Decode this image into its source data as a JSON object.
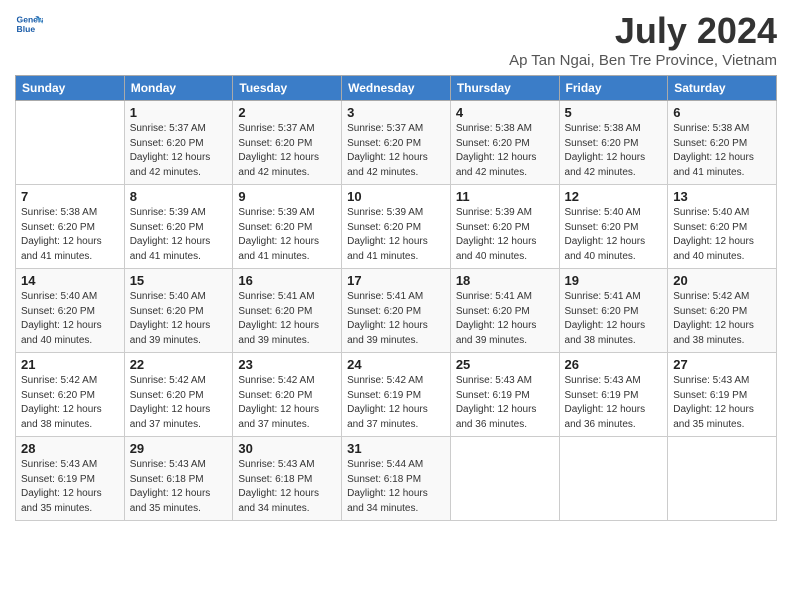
{
  "header": {
    "logo_line1": "General",
    "logo_line2": "Blue",
    "title": "July 2024",
    "subtitle": "Ap Tan Ngai, Ben Tre Province, Vietnam"
  },
  "days_of_week": [
    "Sunday",
    "Monday",
    "Tuesday",
    "Wednesday",
    "Thursday",
    "Friday",
    "Saturday"
  ],
  "weeks": [
    [
      {
        "day": "",
        "sunrise": "",
        "sunset": "",
        "daylight": ""
      },
      {
        "day": "1",
        "sunrise": "5:37 AM",
        "sunset": "6:20 PM",
        "daylight": "12 hours and 42 minutes."
      },
      {
        "day": "2",
        "sunrise": "5:37 AM",
        "sunset": "6:20 PM",
        "daylight": "12 hours and 42 minutes."
      },
      {
        "day": "3",
        "sunrise": "5:37 AM",
        "sunset": "6:20 PM",
        "daylight": "12 hours and 42 minutes."
      },
      {
        "day": "4",
        "sunrise": "5:38 AM",
        "sunset": "6:20 PM",
        "daylight": "12 hours and 42 minutes."
      },
      {
        "day": "5",
        "sunrise": "5:38 AM",
        "sunset": "6:20 PM",
        "daylight": "12 hours and 42 minutes."
      },
      {
        "day": "6",
        "sunrise": "5:38 AM",
        "sunset": "6:20 PM",
        "daylight": "12 hours and 41 minutes."
      }
    ],
    [
      {
        "day": "7",
        "sunrise": "5:38 AM",
        "sunset": "6:20 PM",
        "daylight": "12 hours and 41 minutes."
      },
      {
        "day": "8",
        "sunrise": "5:39 AM",
        "sunset": "6:20 PM",
        "daylight": "12 hours and 41 minutes."
      },
      {
        "day": "9",
        "sunrise": "5:39 AM",
        "sunset": "6:20 PM",
        "daylight": "12 hours and 41 minutes."
      },
      {
        "day": "10",
        "sunrise": "5:39 AM",
        "sunset": "6:20 PM",
        "daylight": "12 hours and 41 minutes."
      },
      {
        "day": "11",
        "sunrise": "5:39 AM",
        "sunset": "6:20 PM",
        "daylight": "12 hours and 40 minutes."
      },
      {
        "day": "12",
        "sunrise": "5:40 AM",
        "sunset": "6:20 PM",
        "daylight": "12 hours and 40 minutes."
      },
      {
        "day": "13",
        "sunrise": "5:40 AM",
        "sunset": "6:20 PM",
        "daylight": "12 hours and 40 minutes."
      }
    ],
    [
      {
        "day": "14",
        "sunrise": "5:40 AM",
        "sunset": "6:20 PM",
        "daylight": "12 hours and 40 minutes."
      },
      {
        "day": "15",
        "sunrise": "5:40 AM",
        "sunset": "6:20 PM",
        "daylight": "12 hours and 39 minutes."
      },
      {
        "day": "16",
        "sunrise": "5:41 AM",
        "sunset": "6:20 PM",
        "daylight": "12 hours and 39 minutes."
      },
      {
        "day": "17",
        "sunrise": "5:41 AM",
        "sunset": "6:20 PM",
        "daylight": "12 hours and 39 minutes."
      },
      {
        "day": "18",
        "sunrise": "5:41 AM",
        "sunset": "6:20 PM",
        "daylight": "12 hours and 39 minutes."
      },
      {
        "day": "19",
        "sunrise": "5:41 AM",
        "sunset": "6:20 PM",
        "daylight": "12 hours and 38 minutes."
      },
      {
        "day": "20",
        "sunrise": "5:42 AM",
        "sunset": "6:20 PM",
        "daylight": "12 hours and 38 minutes."
      }
    ],
    [
      {
        "day": "21",
        "sunrise": "5:42 AM",
        "sunset": "6:20 PM",
        "daylight": "12 hours and 38 minutes."
      },
      {
        "day": "22",
        "sunrise": "5:42 AM",
        "sunset": "6:20 PM",
        "daylight": "12 hours and 37 minutes."
      },
      {
        "day": "23",
        "sunrise": "5:42 AM",
        "sunset": "6:20 PM",
        "daylight": "12 hours and 37 minutes."
      },
      {
        "day": "24",
        "sunrise": "5:42 AM",
        "sunset": "6:19 PM",
        "daylight": "12 hours and 37 minutes."
      },
      {
        "day": "25",
        "sunrise": "5:43 AM",
        "sunset": "6:19 PM",
        "daylight": "12 hours and 36 minutes."
      },
      {
        "day": "26",
        "sunrise": "5:43 AM",
        "sunset": "6:19 PM",
        "daylight": "12 hours and 36 minutes."
      },
      {
        "day": "27",
        "sunrise": "5:43 AM",
        "sunset": "6:19 PM",
        "daylight": "12 hours and 35 minutes."
      }
    ],
    [
      {
        "day": "28",
        "sunrise": "5:43 AM",
        "sunset": "6:19 PM",
        "daylight": "12 hours and 35 minutes."
      },
      {
        "day": "29",
        "sunrise": "5:43 AM",
        "sunset": "6:18 PM",
        "daylight": "12 hours and 35 minutes."
      },
      {
        "day": "30",
        "sunrise": "5:43 AM",
        "sunset": "6:18 PM",
        "daylight": "12 hours and 34 minutes."
      },
      {
        "day": "31",
        "sunrise": "5:44 AM",
        "sunset": "6:18 PM",
        "daylight": "12 hours and 34 minutes."
      },
      {
        "day": "",
        "sunrise": "",
        "sunset": "",
        "daylight": ""
      },
      {
        "day": "",
        "sunrise": "",
        "sunset": "",
        "daylight": ""
      },
      {
        "day": "",
        "sunrise": "",
        "sunset": "",
        "daylight": ""
      }
    ]
  ]
}
